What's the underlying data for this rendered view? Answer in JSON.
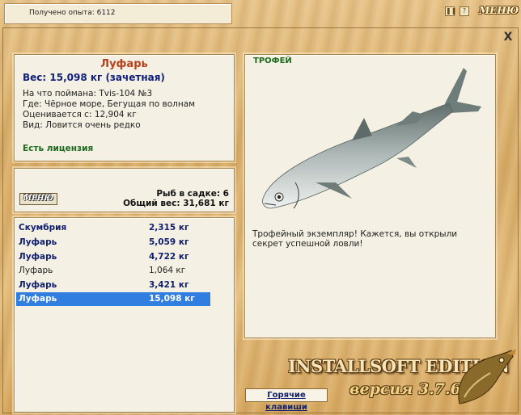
{
  "top": {
    "experience_text": "Получено опыта: 6112",
    "pause_icon": "pause-icon",
    "help_icon": "help-icon",
    "menu_logo": "МЕНЮ"
  },
  "fish": {
    "name": "Луфарь",
    "weight": "Вес: 15,098 кг (зачетная)",
    "caught_with": "На что поймана: Tvis-104 №3",
    "where": "Где: Чёрное море, Бегущая по волнам",
    "valued_from": "Оценивается с: 12,904 кг",
    "kind": "Вид: Ловится очень редко",
    "license": "Есть лицензия"
  },
  "cage": {
    "menu_label": "МЕНЮ",
    "fish_count": "Рыб в садке: 6",
    "total_weight": "Общий вес: 31,681 кг"
  },
  "catch_list": [
    {
      "name": "Скумбрия",
      "weight": "2,315 кг",
      "style": "bold"
    },
    {
      "name": "Луфарь",
      "weight": "5,059 кг",
      "style": "bold"
    },
    {
      "name": "Луфарь",
      "weight": "4,722 кг",
      "style": "bold"
    },
    {
      "name": "Луфарь",
      "weight": "1,064 кг",
      "style": "plain"
    },
    {
      "name": "Луфарь",
      "weight": "3,421 кг",
      "style": "bold"
    },
    {
      "name": "Луфарь",
      "weight": "15,098 кг",
      "style": "selected"
    }
  ],
  "trophy": {
    "title": "ТРОФЕЙ",
    "description": "Трофейный экземпляр! Кажется, вы открыли секрет успешной ловли!"
  },
  "brand": {
    "edition": "INSTALLSOFT EDITION",
    "version": "версия 3.7.6"
  },
  "hotkeys_label": "Горячие клавиши",
  "close_label": "X"
}
